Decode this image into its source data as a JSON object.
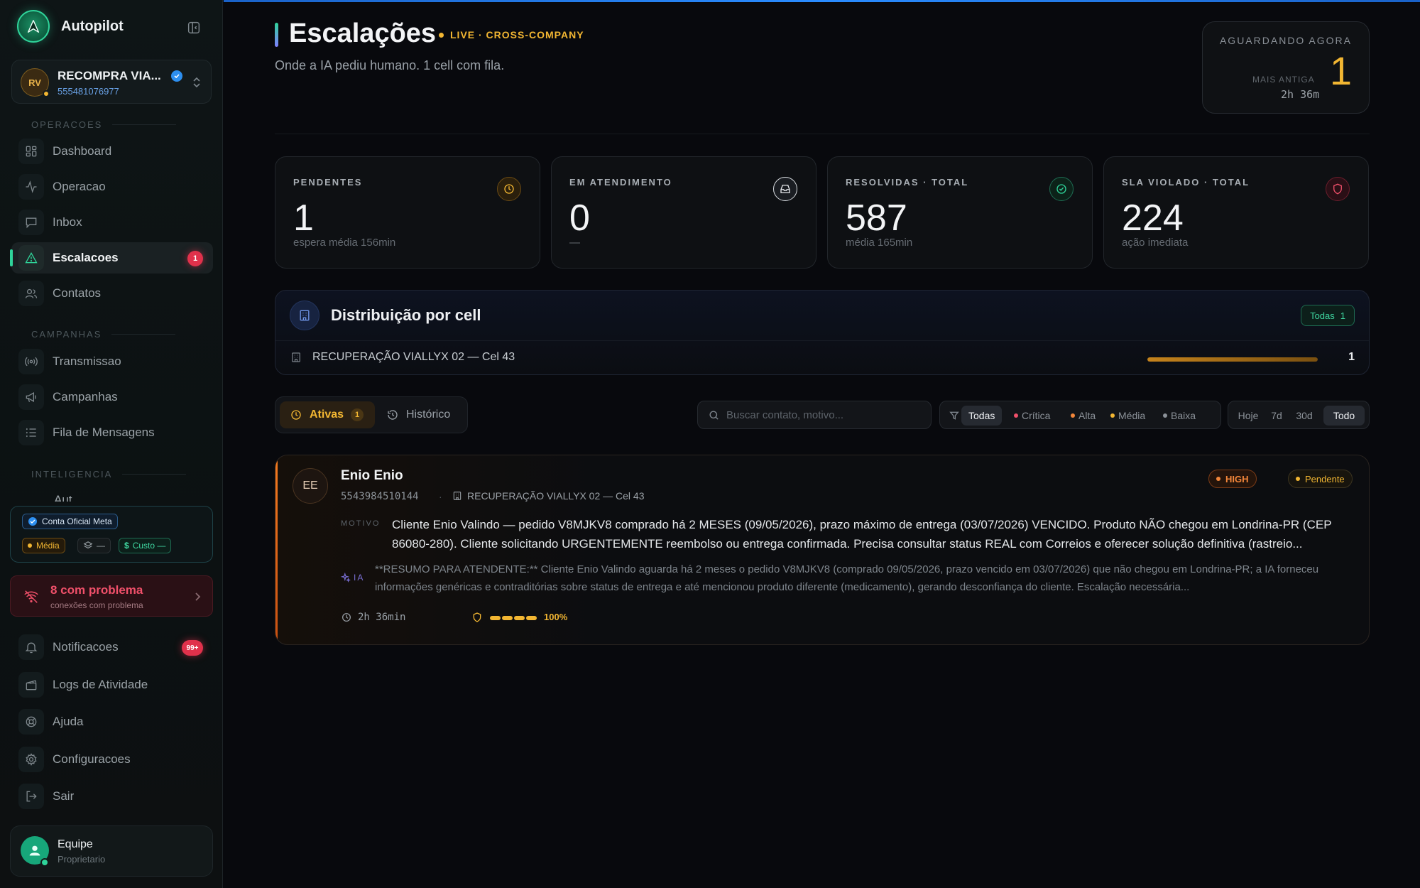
{
  "app": {
    "name": "Autopilot"
  },
  "account": {
    "initials": "RV",
    "name": "RECOMPRA VIA...",
    "phone": "555481076977"
  },
  "sidebar": {
    "sections": [
      "OPERACOES",
      "CAMPANHAS",
      "INTELIGENCIA"
    ],
    "items": [
      {
        "label": "Dashboard",
        "icon": "dashboard-icon"
      },
      {
        "label": "Operacao",
        "icon": "activity-icon"
      },
      {
        "label": "Inbox",
        "icon": "message-icon"
      },
      {
        "label": "Escalacoes",
        "icon": "alert-triangle-icon",
        "badge": "1",
        "active": true
      },
      {
        "label": "Contatos",
        "icon": "users-icon"
      },
      {
        "label": "Transmissao",
        "icon": "broadcast-icon"
      },
      {
        "label": "Campanhas",
        "icon": "megaphone-icon"
      },
      {
        "label": "Fila de Mensagens",
        "icon": "list-icon"
      }
    ],
    "truncated_item": "Aut",
    "meta": {
      "official_label": "Conta Oficial Meta",
      "quality_label": "Média",
      "layers_label": "—",
      "cost_label": "Custo —"
    },
    "problem": {
      "title": "8 com problema",
      "subtitle": "conexões com problema"
    },
    "bottom_items": [
      {
        "label": "Notificacoes",
        "icon": "bell-icon",
        "badge": "99+"
      },
      {
        "label": "Logs de Atividade",
        "icon": "clapperboard-icon"
      },
      {
        "label": "Ajuda",
        "icon": "lifebuoy-icon"
      },
      {
        "label": "Configuracoes",
        "icon": "gear-icon"
      },
      {
        "label": "Sair",
        "icon": "logout-icon"
      }
    ],
    "user": {
      "name": "Equipe",
      "role": "Proprietario"
    }
  },
  "header": {
    "title": "Escalações",
    "live_tag": "LIVE · CROSS-COMPANY",
    "subtitle": "Onde a IA pediu humano. 1 cell com fila.",
    "waiting": {
      "label": "AGUARDANDO AGORA",
      "count": "1",
      "oldest_label": "MAIS ANTIGA",
      "oldest_time": "2h 36m"
    }
  },
  "stats": [
    {
      "label": "PENDENTES",
      "value": "1",
      "sub": "espera média 156min",
      "icon": "clock-icon",
      "color": "#f2b632"
    },
    {
      "label": "EM ATENDIMENTO",
      "value": "0",
      "sub": "—",
      "icon": "inbox-icon",
      "color": "#e6e8ec"
    },
    {
      "label": "RESOLVIDAS · TOTAL",
      "value": "587",
      "sub": "média 165min",
      "icon": "check-circle-icon",
      "color": "#2fd49a"
    },
    {
      "label": "SLA VIOLADO · TOTAL",
      "value": "224",
      "sub": "ação imediata",
      "icon": "shield-icon",
      "color": "#e0314b"
    }
  ],
  "distribution": {
    "title": "Distribuição por cell",
    "all_label": "Todas",
    "all_count": "1",
    "rows": [
      {
        "label": "RECUPERAÇÃO VIALLYX 02 — Cel 43",
        "count": "1",
        "fill_fraction": 1.0
      }
    ]
  },
  "tabs": [
    {
      "label": "Ativas",
      "count": "1",
      "active": true
    },
    {
      "label": "Histórico",
      "active": false
    }
  ],
  "search": {
    "placeholder": "Buscar contato, motivo..."
  },
  "severity_filters": [
    {
      "label": "Todas",
      "active": true
    },
    {
      "label": "Crítica",
      "color": "#f0506a"
    },
    {
      "label": "Alta",
      "color": "#f2863a"
    },
    {
      "label": "Média",
      "color": "#f2b632"
    },
    {
      "label": "Baixa",
      "color": "#8b9198"
    }
  ],
  "range_filters": [
    {
      "label": "Hoje"
    },
    {
      "label": "7d"
    },
    {
      "label": "30d"
    },
    {
      "label": "Todo",
      "active": true
    }
  ],
  "escalations": [
    {
      "initials": "EE",
      "name": "Enio Enio",
      "phone": "5543984510144",
      "separator": "·",
      "cell": "RECUPERAÇÃO VIALLYX 02 — Cel 43",
      "priority": "HIGH",
      "status": "Pendente",
      "motivo_label": "MOTIVO",
      "motivo": "Cliente Enio Valindo — pedido V8MJKV8 comprado há 2 MESES (09/05/2026), prazo máximo de entrega (03/07/2026) VENCIDO. Produto NÃO chegou em Londrina-PR (CEP 86080-280). Cliente solicitando URGENTEMENTE reembolso ou entrega confirmada. Precisa consultar status REAL com Correios e oferecer solução definitiva (rastreio...",
      "ia_label": "IA",
      "ia_summary": "**RESUMO PARA ATENDENTE:** Cliente Enio Valindo aguarda há 2 meses o pedido V8MJKV8 (comprado 09/05/2026, prazo vencido em 03/07/2026) que não chegou em Londrina-PR; a IA forneceu informações genéricas e contraditórias sobre status de entrega e até mencionou produto diferente (medicamento), gerando desconfiança do cliente. Escalação necessária...",
      "wait_time": "2h 36min",
      "confidence_label": "100%",
      "confidence": 1.0
    }
  ],
  "colors": {
    "accent": "#2fd49a",
    "warning": "#f2b632",
    "danger": "#e0314b",
    "high": "#f2863a"
  }
}
